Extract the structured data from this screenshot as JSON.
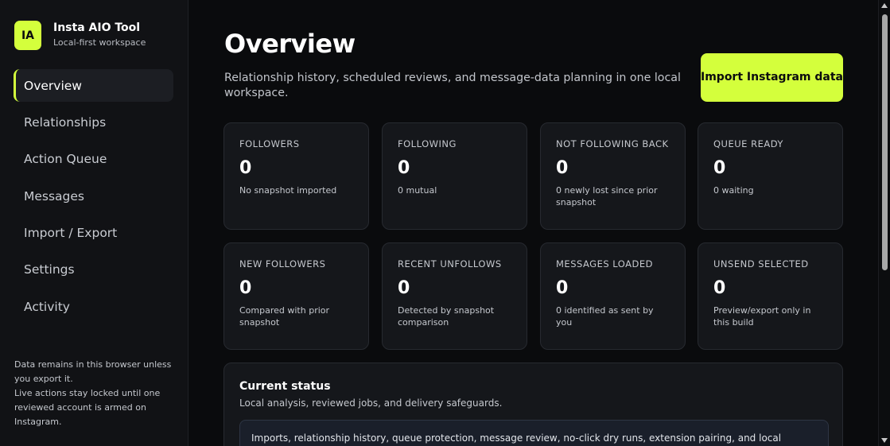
{
  "brand": {
    "logo": "IA",
    "name": "Insta AIO Tool",
    "subtitle": "Local-first workspace"
  },
  "nav": [
    {
      "label": "Overview",
      "active": true
    },
    {
      "label": "Relationships"
    },
    {
      "label": "Action Queue"
    },
    {
      "label": "Messages"
    },
    {
      "label": "Import / Export"
    },
    {
      "label": "Settings"
    },
    {
      "label": "Activity"
    }
  ],
  "sidebar_note": "Data remains in this browser unless you export it.\nLive actions stay locked until one reviewed account is armed on Instagram.",
  "header": {
    "title": "Overview",
    "description": "Relationship history, scheduled reviews, and message-data planning in one local workspace.",
    "import_button": "Import Instagram data"
  },
  "stats": [
    {
      "label": "FOLLOWERS",
      "value": "0",
      "note": "No snapshot imported"
    },
    {
      "label": "FOLLOWING",
      "value": "0",
      "note": "0 mutual"
    },
    {
      "label": "NOT FOLLOWING BACK",
      "value": "0",
      "note": "0 newly lost since prior snapshot"
    },
    {
      "label": "QUEUE READY",
      "value": "0",
      "note": "0 waiting"
    },
    {
      "label": "NEW FOLLOWERS",
      "value": "0",
      "note": "Compared with prior snapshot"
    },
    {
      "label": "RECENT UNFOLLOWS",
      "value": "0",
      "note": "Detected by snapshot comparison"
    },
    {
      "label": "MESSAGES LOADED",
      "value": "0",
      "note": "0 identified as sent by you"
    },
    {
      "label": "UNSEND SELECTED",
      "value": "0",
      "note": "Preview/export only in this build"
    }
  ],
  "status": {
    "title": "Current status",
    "subtitle": "Local analysis, reviewed jobs, and delivery safeguards.",
    "message": "Imports, relationship history, queue protection, message review, no-click dry runs, extension pairing, and local exports are"
  },
  "colors": {
    "accent": "#d4ff3c",
    "background": "#0a0b0d",
    "card": "#15171b"
  }
}
